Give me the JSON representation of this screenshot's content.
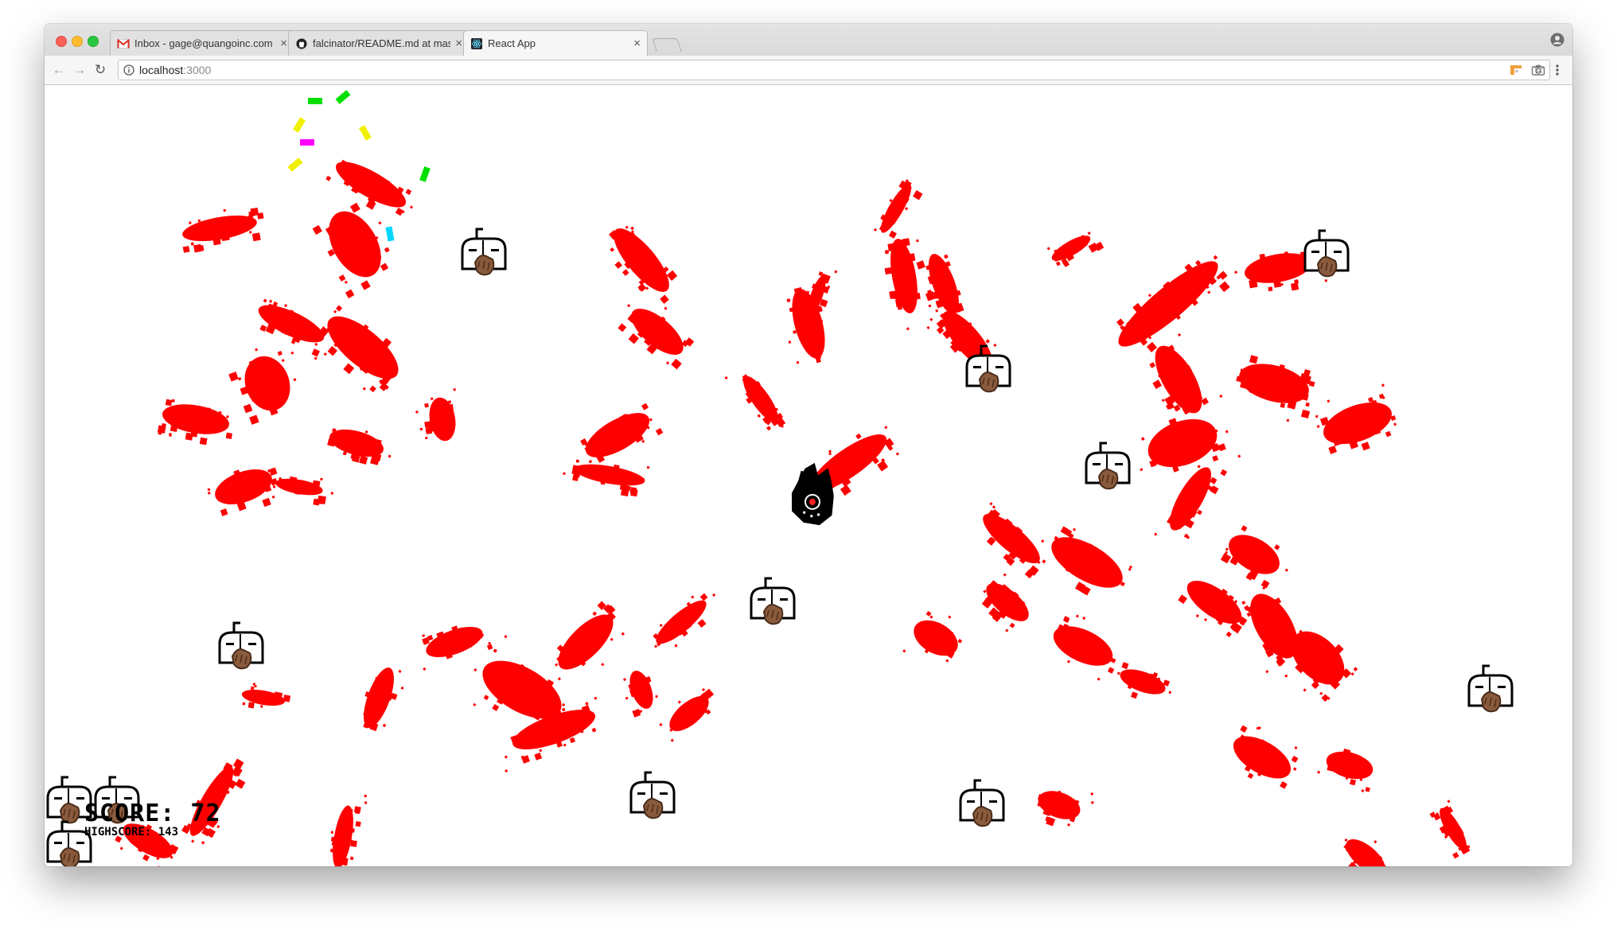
{
  "browser": {
    "tabs": [
      {
        "title": "Inbox - gage@quangoinc.com",
        "icon": "gmail-icon",
        "active": false
      },
      {
        "title": "falcinator/README.md at mas",
        "icon": "github-icon",
        "active": false
      },
      {
        "title": "React App",
        "icon": "react-icon",
        "active": true
      }
    ],
    "address": {
      "host": "localhost",
      "port": ":3000"
    }
  },
  "game": {
    "score_label": "SCORE: 72",
    "highscore_label": "HIGHSCORE: 143",
    "colors": {
      "splatter": "#ff0000",
      "player": "#000000",
      "background": "#ffffff"
    },
    "particles": [
      {
        "color": "#00e000"
      },
      {
        "color": "#00e000"
      },
      {
        "color": "#f0f000"
      },
      {
        "color": "#f0f000"
      },
      {
        "color": "#ff00ff"
      },
      {
        "color": "#f0f000"
      },
      {
        "color": "#00e000"
      },
      {
        "color": "#00d8ff"
      }
    ],
    "entities": {
      "player": "player-ship-icon",
      "mailbox_count": 12
    }
  }
}
